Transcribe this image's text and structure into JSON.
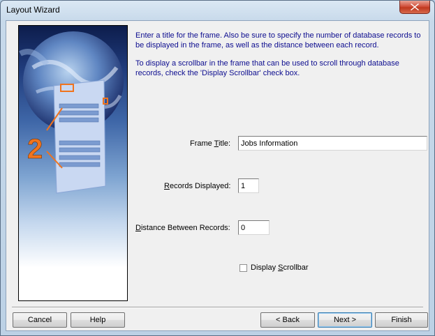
{
  "window": {
    "title": "Layout Wizard",
    "close_icon": "close-icon"
  },
  "instructions": {
    "line1": "Enter a title for the frame. Also be sure to specify the number of database records to be displayed in the frame, as well as the distance between each record.",
    "line2": "To display a scrollbar in the frame that can be used to scroll through database records, check the 'Display Scrollbar' check box."
  },
  "illustration": {
    "step_number": "2"
  },
  "form": {
    "frame_title": {
      "label_pre": "Frame ",
      "label_key": "T",
      "label_post": "itle:",
      "value": "Jobs Information"
    },
    "records_displayed": {
      "label_pre": "",
      "label_key": "R",
      "label_post": "ecords Displayed:",
      "value": "1"
    },
    "distance": {
      "label_pre": "",
      "label_key": "D",
      "label_post": "istance Between Records:",
      "value": "0"
    },
    "display_scrollbar": {
      "label_pre": "Display ",
      "label_key": "S",
      "label_post": "crollbar",
      "checked": false
    }
  },
  "buttons": {
    "cancel": "Cancel",
    "help": "Help",
    "back": "< Back",
    "next": "Next >",
    "finish": "Finish"
  },
  "colors": {
    "instruction_text": "#0d0d8f",
    "accent_orange": "#f0741e"
  }
}
